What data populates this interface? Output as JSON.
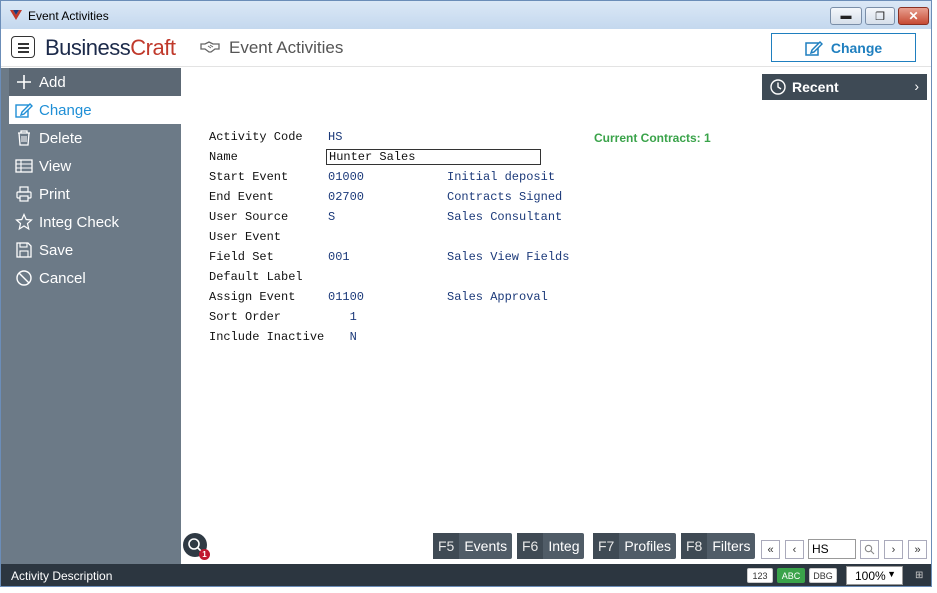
{
  "window": {
    "title": "Event Activities",
    "min_glyph": "▬",
    "max_glyph": "❐",
    "close_glyph": "✕"
  },
  "header": {
    "logo_part1": "Business",
    "logo_part2": "Craft",
    "page_title": "Event Activities",
    "change_button": "Change",
    "page_icon": "handshake-icon"
  },
  "sidebar": {
    "items": [
      {
        "label": "Add",
        "icon": "plus-icon"
      },
      {
        "label": "Change",
        "icon": "edit-icon"
      },
      {
        "label": "Delete",
        "icon": "trash-icon"
      },
      {
        "label": "View",
        "icon": "table-icon"
      },
      {
        "label": "Print",
        "icon": "printer-icon"
      },
      {
        "label": "Integ Check",
        "icon": "star-icon"
      },
      {
        "label": "Save",
        "icon": "save-icon"
      },
      {
        "label": "Cancel",
        "icon": "cancel-icon"
      }
    ]
  },
  "recent": {
    "label": "Recent"
  },
  "form": {
    "current_contracts": "Current Contracts: 1",
    "fields": [
      {
        "label": "Activity Code",
        "value": "HS",
        "desc": ""
      },
      {
        "label": "Name",
        "value": "Hunter Sales",
        "desc": ""
      },
      {
        "label": "Start Event",
        "value": "01000",
        "desc": "Initial deposit"
      },
      {
        "label": "End Event",
        "value": "02700",
        "desc": "Contracts Signed"
      },
      {
        "label": "User Source",
        "value": "S",
        "desc": "Sales Consultant"
      },
      {
        "label": "User Event",
        "value": "",
        "desc": ""
      },
      {
        "label": "Field Set",
        "value": "001",
        "desc": "Sales View Fields"
      },
      {
        "label": "Default Label",
        "value": "",
        "desc": ""
      },
      {
        "label": "Assign Event",
        "value": "01100",
        "desc": "Sales Approval"
      },
      {
        "label": "Sort Order",
        "value": "   1",
        "desc": ""
      },
      {
        "label": "Include Inactive",
        "value": "   N",
        "desc": ""
      }
    ]
  },
  "toolbar": {
    "search_badge": "1",
    "fkeys": [
      {
        "key": "F5",
        "label": "Events"
      },
      {
        "key": "F6",
        "label": "Integ"
      },
      {
        "key": "F7",
        "label": "Profiles"
      },
      {
        "key": "F8",
        "label": "Filters"
      }
    ],
    "nav_value": "HS"
  },
  "status": {
    "description": "Activity Description",
    "badge_123": "123",
    "badge_abc": "ABC",
    "badge_dbg": "DBG",
    "zoom": "100%"
  },
  "colors": {
    "accent": "#1f8fd6",
    "sidebar": "#6c7a87",
    "contracts": "#3aa34a",
    "status_bar": "#2c3640"
  }
}
